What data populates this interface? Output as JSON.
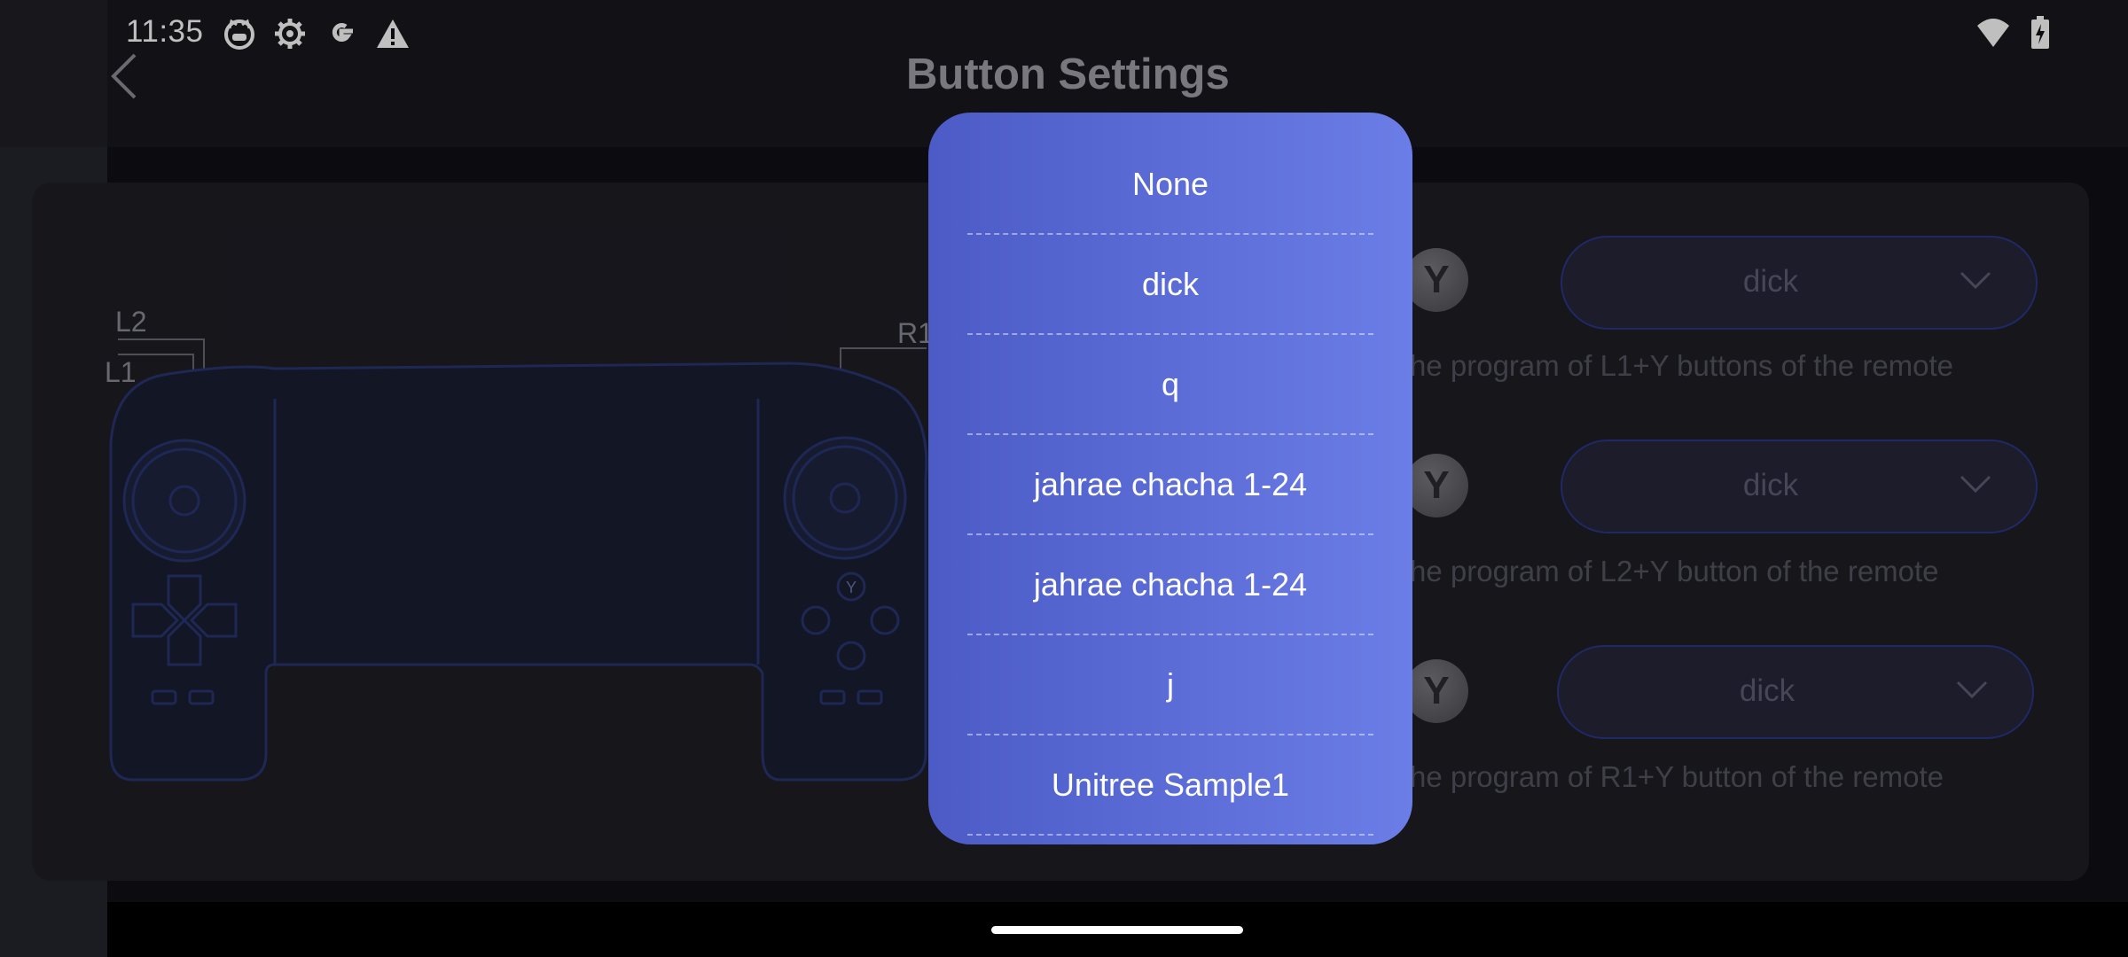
{
  "status_bar": {
    "time": "11:35",
    "left_icons": [
      "cat-icon",
      "gear-icon",
      "google-icon",
      "warning-icon"
    ],
    "right_icons": [
      "wifi-icon",
      "battery-charging-icon"
    ]
  },
  "header": {
    "title": "Button Settings",
    "back_icon": "chevron-left-icon"
  },
  "controller": {
    "labels": [
      "L2",
      "L1",
      "R1"
    ]
  },
  "rows": [
    {
      "combo": "Y",
      "selected": "dick",
      "description": "he program of L1+Y buttons of the remote"
    },
    {
      "combo": "Y",
      "selected": "dick",
      "description": "he program of L2+Y button of the remote"
    },
    {
      "combo": "Y",
      "selected": "dick",
      "description": "he program of R1+Y button of the remote"
    }
  ],
  "popup": {
    "options": [
      "None",
      "dick",
      "q",
      "jahrae chacha 1-24",
      "jahrae chacha 1-24",
      "j",
      "Unitree Sample1"
    ]
  },
  "colors": {
    "background": "#111116",
    "popup_start": "#4c5bc6",
    "popup_end": "#6b7de6",
    "dropdown_border": "#2b3688"
  }
}
